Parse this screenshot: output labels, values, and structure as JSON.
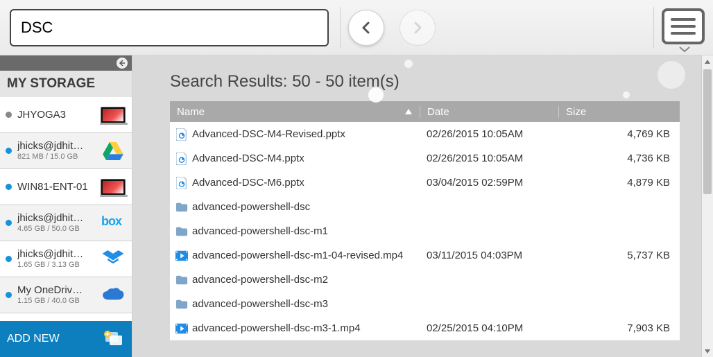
{
  "search": {
    "value": "DSC"
  },
  "sidebar": {
    "title": "MY STORAGE",
    "items": [
      {
        "name": "JHYOGA3",
        "meta": "",
        "dot": "grey",
        "icon": "laptop"
      },
      {
        "name": "jhicks@jdhit…",
        "meta": "821 MB / 15.0 GB",
        "dot": "blue",
        "icon": "gdrive"
      },
      {
        "name": "WIN81-ENT-01",
        "meta": "",
        "dot": "blue",
        "icon": "laptop"
      },
      {
        "name": "jhicks@jdhit…",
        "meta": "4.65 GB / 50.0 GB",
        "dot": "blue",
        "icon": "box"
      },
      {
        "name": "jhicks@jdhit…",
        "meta": "1.65 GB / 3.13 GB",
        "dot": "blue",
        "icon": "dropbox"
      },
      {
        "name": "My OneDriv…",
        "meta": "1.15 GB / 40.0 GB",
        "dot": "blue",
        "icon": "onedrive"
      }
    ],
    "add_new": "ADD NEW"
  },
  "results": {
    "title": "Search Results: 50 - 50 item(s)",
    "columns": {
      "name": "Name",
      "date": "Date",
      "size": "Size"
    },
    "rows": [
      {
        "type": "pptx",
        "name": "Advanced-DSC-M4-Revised.pptx",
        "date": "02/26/2015 10:05AM",
        "size": "4,769 KB"
      },
      {
        "type": "pptx",
        "name": "Advanced-DSC-M4.pptx",
        "date": "02/26/2015 10:05AM",
        "size": "4,736 KB"
      },
      {
        "type": "pptx",
        "name": "Advanced-DSC-M6.pptx",
        "date": "03/04/2015 02:59PM",
        "size": "4,879 KB"
      },
      {
        "type": "folder",
        "name": "advanced-powershell-dsc",
        "date": "",
        "size": ""
      },
      {
        "type": "folder",
        "name": "advanced-powershell-dsc-m1",
        "date": "",
        "size": ""
      },
      {
        "type": "mp4",
        "name": "advanced-powershell-dsc-m1-04-revised.mp4",
        "date": "03/11/2015 04:03PM",
        "size": "5,737 KB"
      },
      {
        "type": "folder",
        "name": "advanced-powershell-dsc-m2",
        "date": "",
        "size": ""
      },
      {
        "type": "folder",
        "name": "advanced-powershell-dsc-m3",
        "date": "",
        "size": ""
      },
      {
        "type": "mp4",
        "name": "advanced-powershell-dsc-m3-1.mp4",
        "date": "02/25/2015 04:10PM",
        "size": "7,903 KB"
      }
    ]
  }
}
